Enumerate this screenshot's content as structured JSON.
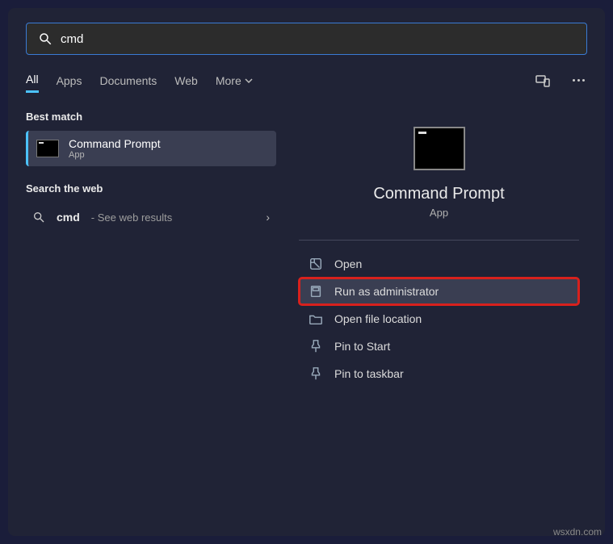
{
  "search": {
    "value": "cmd"
  },
  "tabs": {
    "all": "All",
    "apps": "Apps",
    "documents": "Documents",
    "web": "Web",
    "more": "More"
  },
  "left": {
    "best_match_label": "Best match",
    "best_match": {
      "title": "Command Prompt",
      "subtitle": "App"
    },
    "search_web_label": "Search the web",
    "web_item": {
      "query": "cmd",
      "hint": "- See web results"
    }
  },
  "preview": {
    "title": "Command Prompt",
    "subtitle": "App"
  },
  "actions": {
    "open": "Open",
    "run_admin": "Run as administrator",
    "open_location": "Open file location",
    "pin_start": "Pin to Start",
    "pin_taskbar": "Pin to taskbar"
  },
  "watermark": "wsxdn.com"
}
